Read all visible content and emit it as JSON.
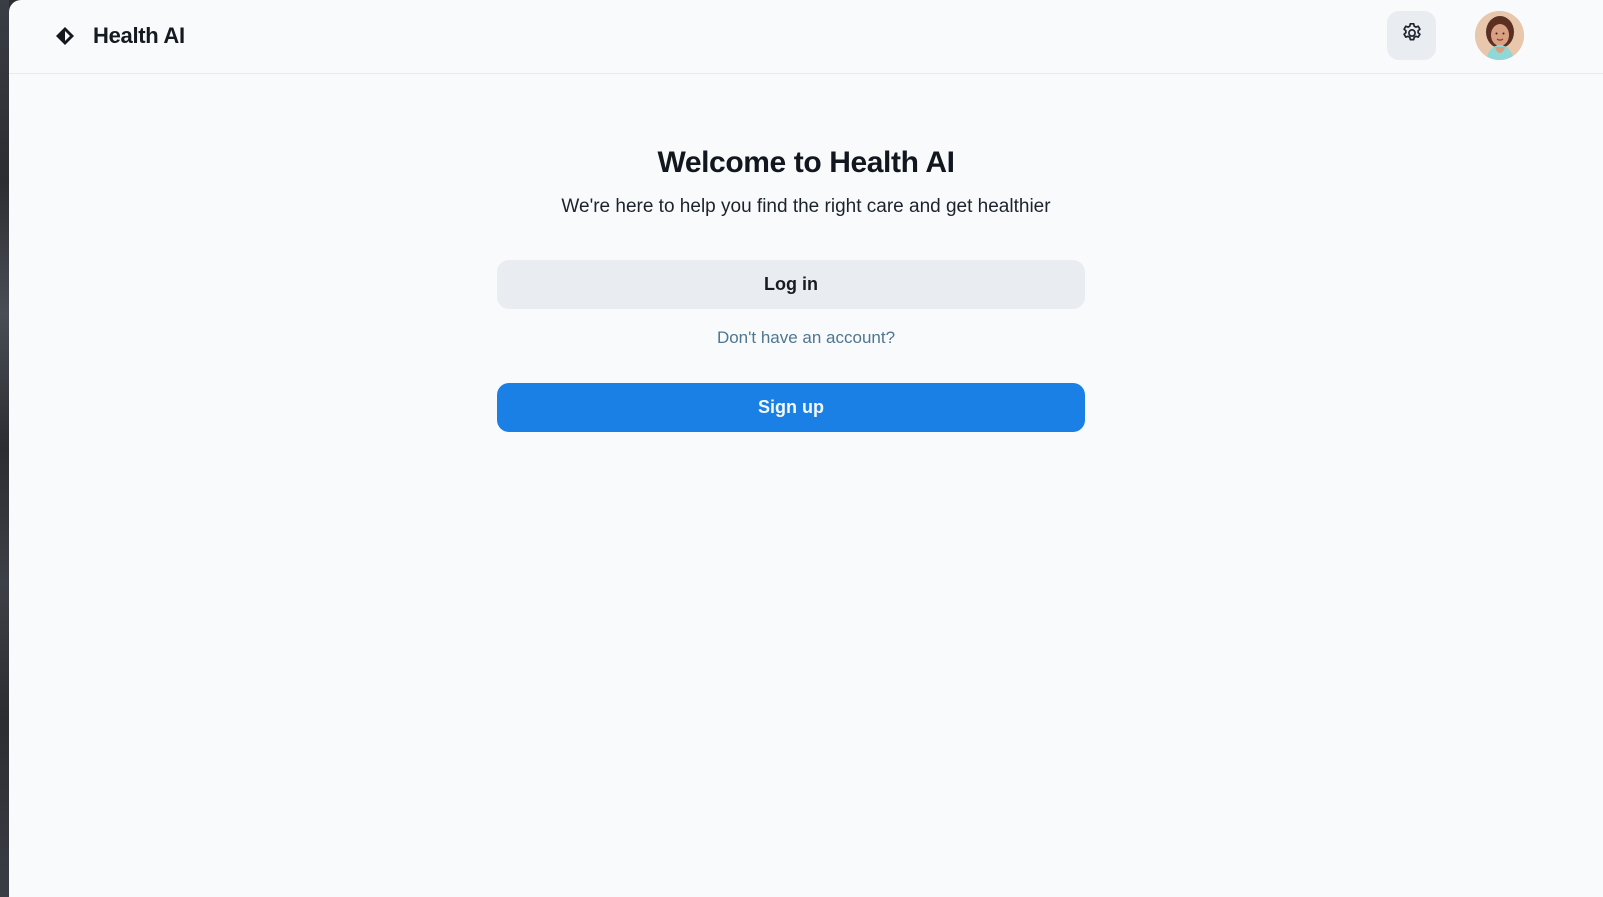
{
  "header": {
    "brand_name": "Health AI",
    "logo_icon": "diamond-logo-icon",
    "settings_icon": "gear-icon",
    "avatar_label": "user-avatar"
  },
  "main": {
    "title": "Welcome to Health AI",
    "subtitle": "We're here to help you find the right care and get healthier",
    "login_label": "Log in",
    "account_prompt": "Don't have an account?",
    "signup_label": "Sign up"
  },
  "colors": {
    "background": "#f8fafc",
    "secondary_button": "#e9edf1",
    "primary_button": "#1a80e6",
    "link_text": "#4f7690",
    "heading_text": "#12171f"
  }
}
